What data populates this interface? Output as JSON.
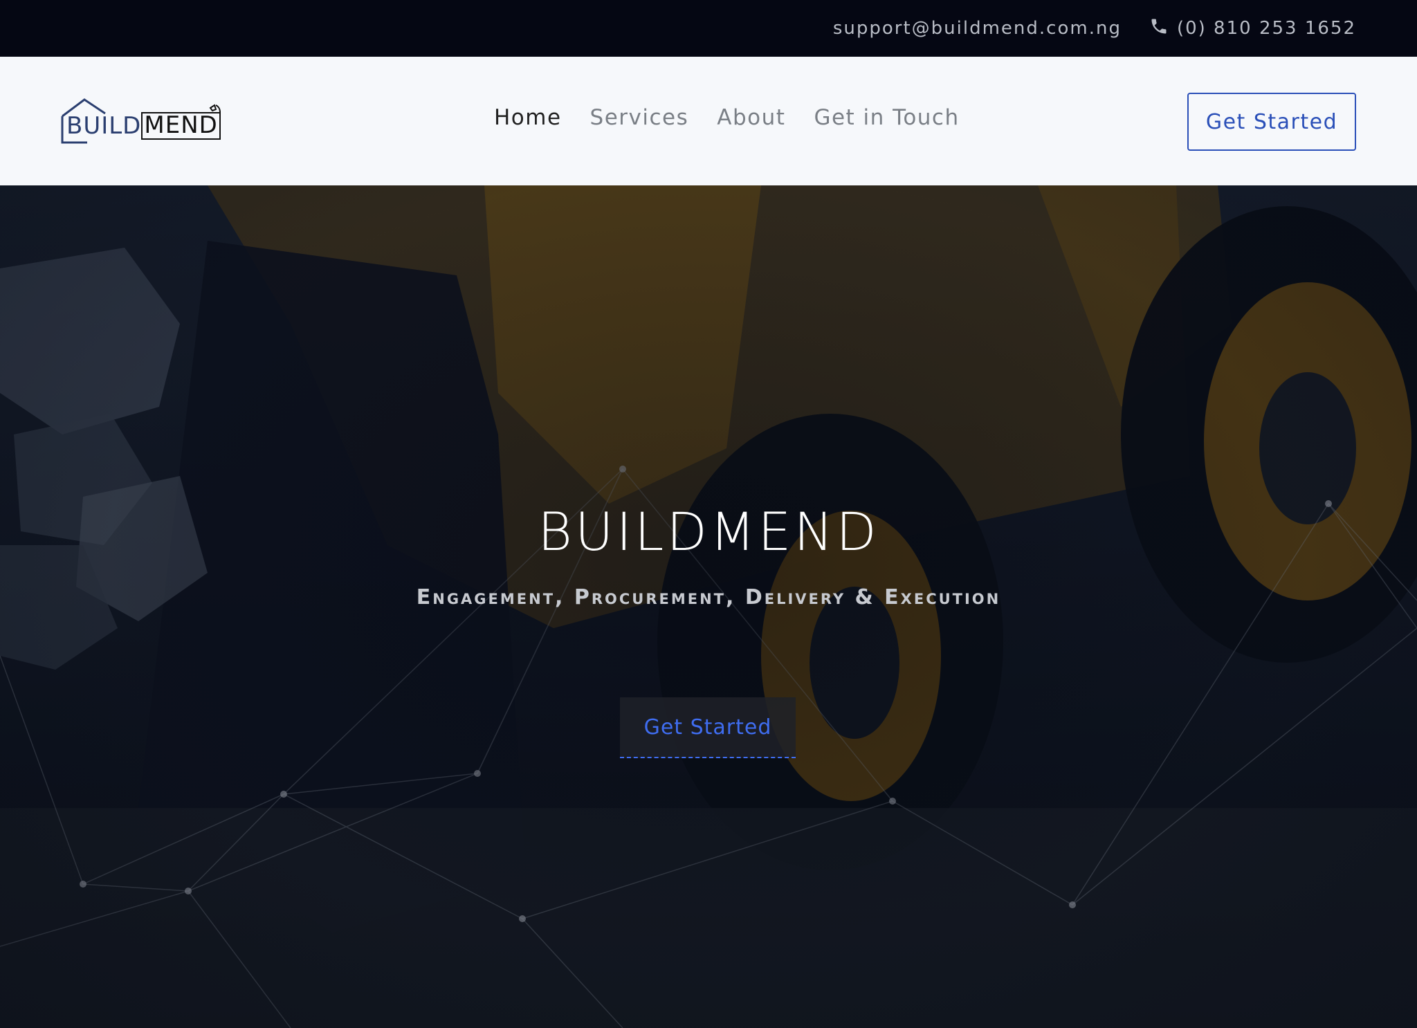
{
  "topbar": {
    "email": "support@buildmend.com.ng",
    "phone": "(0) 810 253 1652"
  },
  "brand": {
    "logo_build": "BUILD",
    "logo_mend": "MEND"
  },
  "nav": {
    "items": [
      {
        "label": "Home",
        "active": true
      },
      {
        "label": "Services",
        "active": false
      },
      {
        "label": "About",
        "active": false
      },
      {
        "label": "Get in Touch",
        "active": false
      }
    ],
    "cta_label": "Get Started"
  },
  "hero": {
    "title": "BUILDMEND",
    "subtitle": "Engagement, Procurement, Delivery & Execution",
    "cta_label": "Get Started"
  },
  "colors": {
    "accent": "#2a4fb8",
    "topbar_bg": "#050713",
    "nav_bg": "#f6f8fb"
  }
}
